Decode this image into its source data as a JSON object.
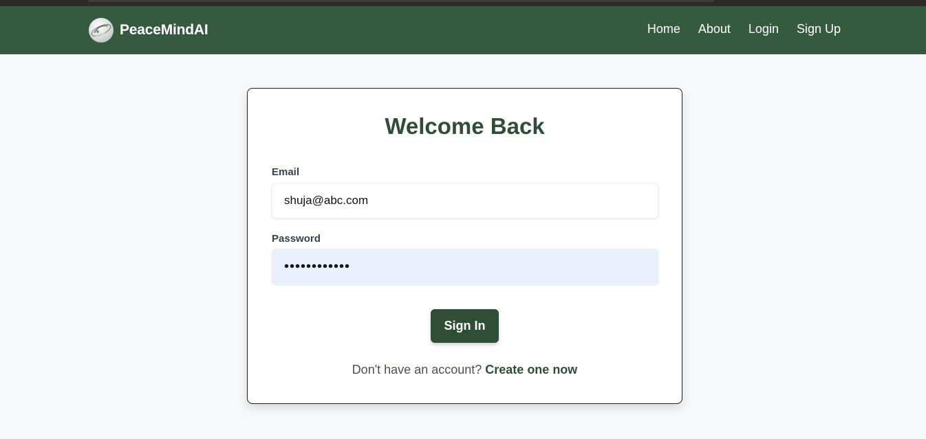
{
  "brand": {
    "name": "PeaceMindAI",
    "logo_icon": "globe-logo-icon"
  },
  "nav": {
    "items": [
      "Home",
      "About",
      "Login",
      "Sign Up"
    ]
  },
  "login": {
    "title": "Welcome Back",
    "email_label": "Email",
    "email_value": "shuja@abc.com",
    "password_label": "Password",
    "password_value": "••••••••••••",
    "submit_label": "Sign In",
    "footer_text": "Don't have an account?",
    "footer_link": "Create one now"
  },
  "colors": {
    "navbar": "#365a3f",
    "primary": "#2e4f35",
    "background": "#f7f8fa",
    "autofill": "#e8f0fe"
  }
}
